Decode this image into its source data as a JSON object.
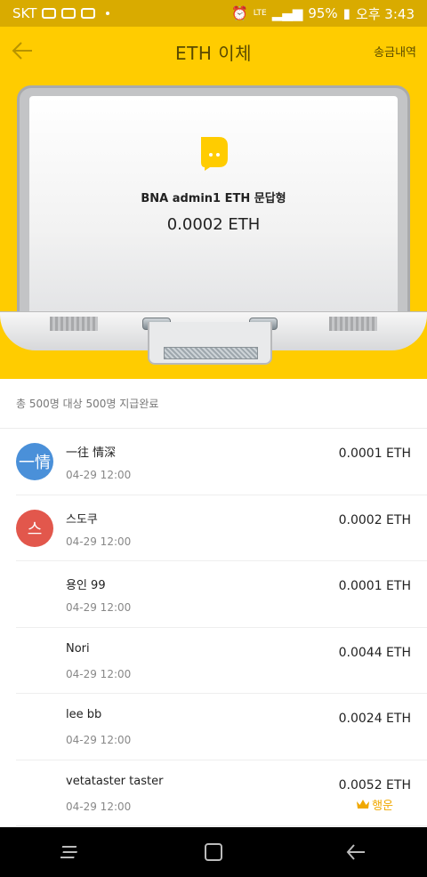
{
  "status_bar": {
    "carrier": "SKT",
    "battery": "95%",
    "time": "오후 3:43",
    "network": "LTE"
  },
  "header": {
    "title": "ETH  이체",
    "history_link": "송금내역"
  },
  "hero": {
    "sender": "BNA admin1  ETH  문답형",
    "amount": "0.0002  ETH"
  },
  "summary": {
    "text": "총 500명 대상 500명 지급완료"
  },
  "recipients": [
    {
      "avatar_text": "一情",
      "avatar_color": "#4a90d9",
      "name": "一往 情深",
      "date": "04-29 12:00",
      "amount": "0.0001 ETH"
    },
    {
      "avatar_text": "스",
      "avatar_color": "#e2574c",
      "name": "스도쿠",
      "date": "04-29 12:00",
      "amount": "0.0002 ETH"
    },
    {
      "name": "용인 99",
      "date": "04-29 12:00",
      "amount": "0.0001 ETH"
    },
    {
      "name": "Nori",
      "date": "04-29 12:00",
      "amount": "0.0044 ETH"
    },
    {
      "name": "lee bb",
      "date": "04-29 12:00",
      "amount": "0.0024 ETH"
    },
    {
      "name": "vetataster taster",
      "date": "04-29 12:00",
      "amount": "0.0052 ETH",
      "badge": "행운"
    }
  ],
  "colors": {
    "brand_yellow": "#ffcc00",
    "status_bar": "#d9ab00",
    "lucky_gold": "#f0a800"
  }
}
